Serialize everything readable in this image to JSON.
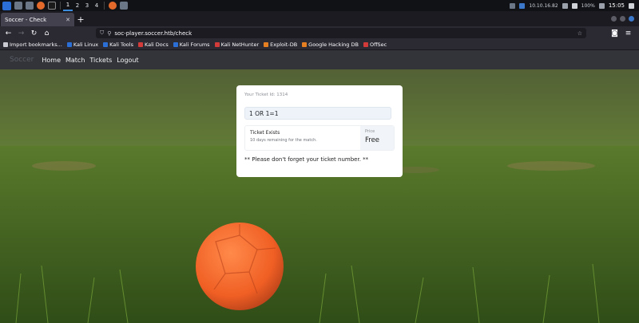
{
  "taskbar": {
    "workspaces": [
      "1",
      "2",
      "3",
      "4"
    ],
    "ip": "10.10.16.82",
    "battery": "100%",
    "time": "15:05"
  },
  "browser": {
    "tab_title": "Soccer - Check",
    "new_tab": "+",
    "url": "soc-player.soccer.htb/check",
    "bookmarks": [
      {
        "label": "Import bookmarks...",
        "color": "#c9c9d1"
      },
      {
        "label": "Kali Linux",
        "color": "#2b6fd6"
      },
      {
        "label": "Kali Tools",
        "color": "#2b6fd6"
      },
      {
        "label": "Kali Docs",
        "color": "#d33a3a"
      },
      {
        "label": "Kali Forums",
        "color": "#2b6fd6"
      },
      {
        "label": "Kali NetHunter",
        "color": "#d33a3a"
      },
      {
        "label": "Exploit-DB",
        "color": "#e67e22"
      },
      {
        "label": "Google Hacking DB",
        "color": "#e67e22"
      },
      {
        "label": "OffSec",
        "color": "#d33a3a"
      }
    ]
  },
  "site": {
    "brand": "Soccer",
    "nav": [
      "Home",
      "Match",
      "Tickets",
      "Logout"
    ]
  },
  "ticket": {
    "id_label": "Your Ticket Id: 1314",
    "input_value": "1 OR 1=1",
    "status_title": "Ticket Exists",
    "status_sub": "10 days remaining for the match.",
    "price_label": "Price",
    "price_value": "Free",
    "reminder": "** Please don't forget your ticket number. **"
  },
  "colors": {
    "accent": "#3b78c9",
    "ball": "#f26a2b",
    "grass": "#4b6a24"
  }
}
